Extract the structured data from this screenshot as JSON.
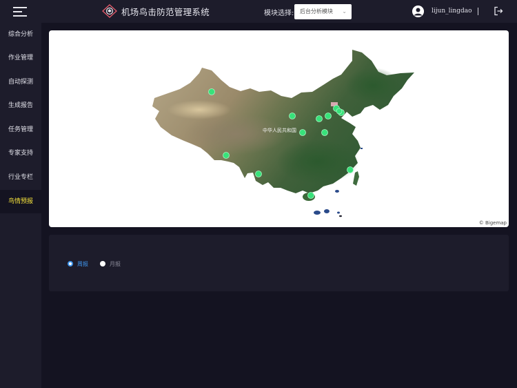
{
  "header": {
    "app_title": "机场鸟击防范管理系统",
    "module_label": "模块选择:",
    "module_selected": "后台分析模块",
    "username": "lijun_lingdao"
  },
  "sidebar": {
    "items": [
      {
        "label": "综合分析",
        "active": false
      },
      {
        "label": "作业管理",
        "active": false
      },
      {
        "label": "自动探测",
        "active": false
      },
      {
        "label": "生成报告",
        "active": false
      },
      {
        "label": "任务管理",
        "active": false
      },
      {
        "label": "专家支持",
        "active": false
      },
      {
        "label": "行业专栏",
        "active": false
      },
      {
        "label": "鸟情预报",
        "active": true
      }
    ]
  },
  "map": {
    "country_label": "中华人民共和国",
    "attribution": "© Bigemap",
    "marker_color": "#38e27a",
    "marker_count": 13
  },
  "report": {
    "options": [
      {
        "label": "周报",
        "checked": true
      },
      {
        "label": "月报",
        "checked": false
      }
    ]
  },
  "colors": {
    "background": "#141321",
    "panel": "#1d1c2b",
    "active_nav_text": "#f5e23c",
    "accent_blue": "#3f95ec"
  }
}
